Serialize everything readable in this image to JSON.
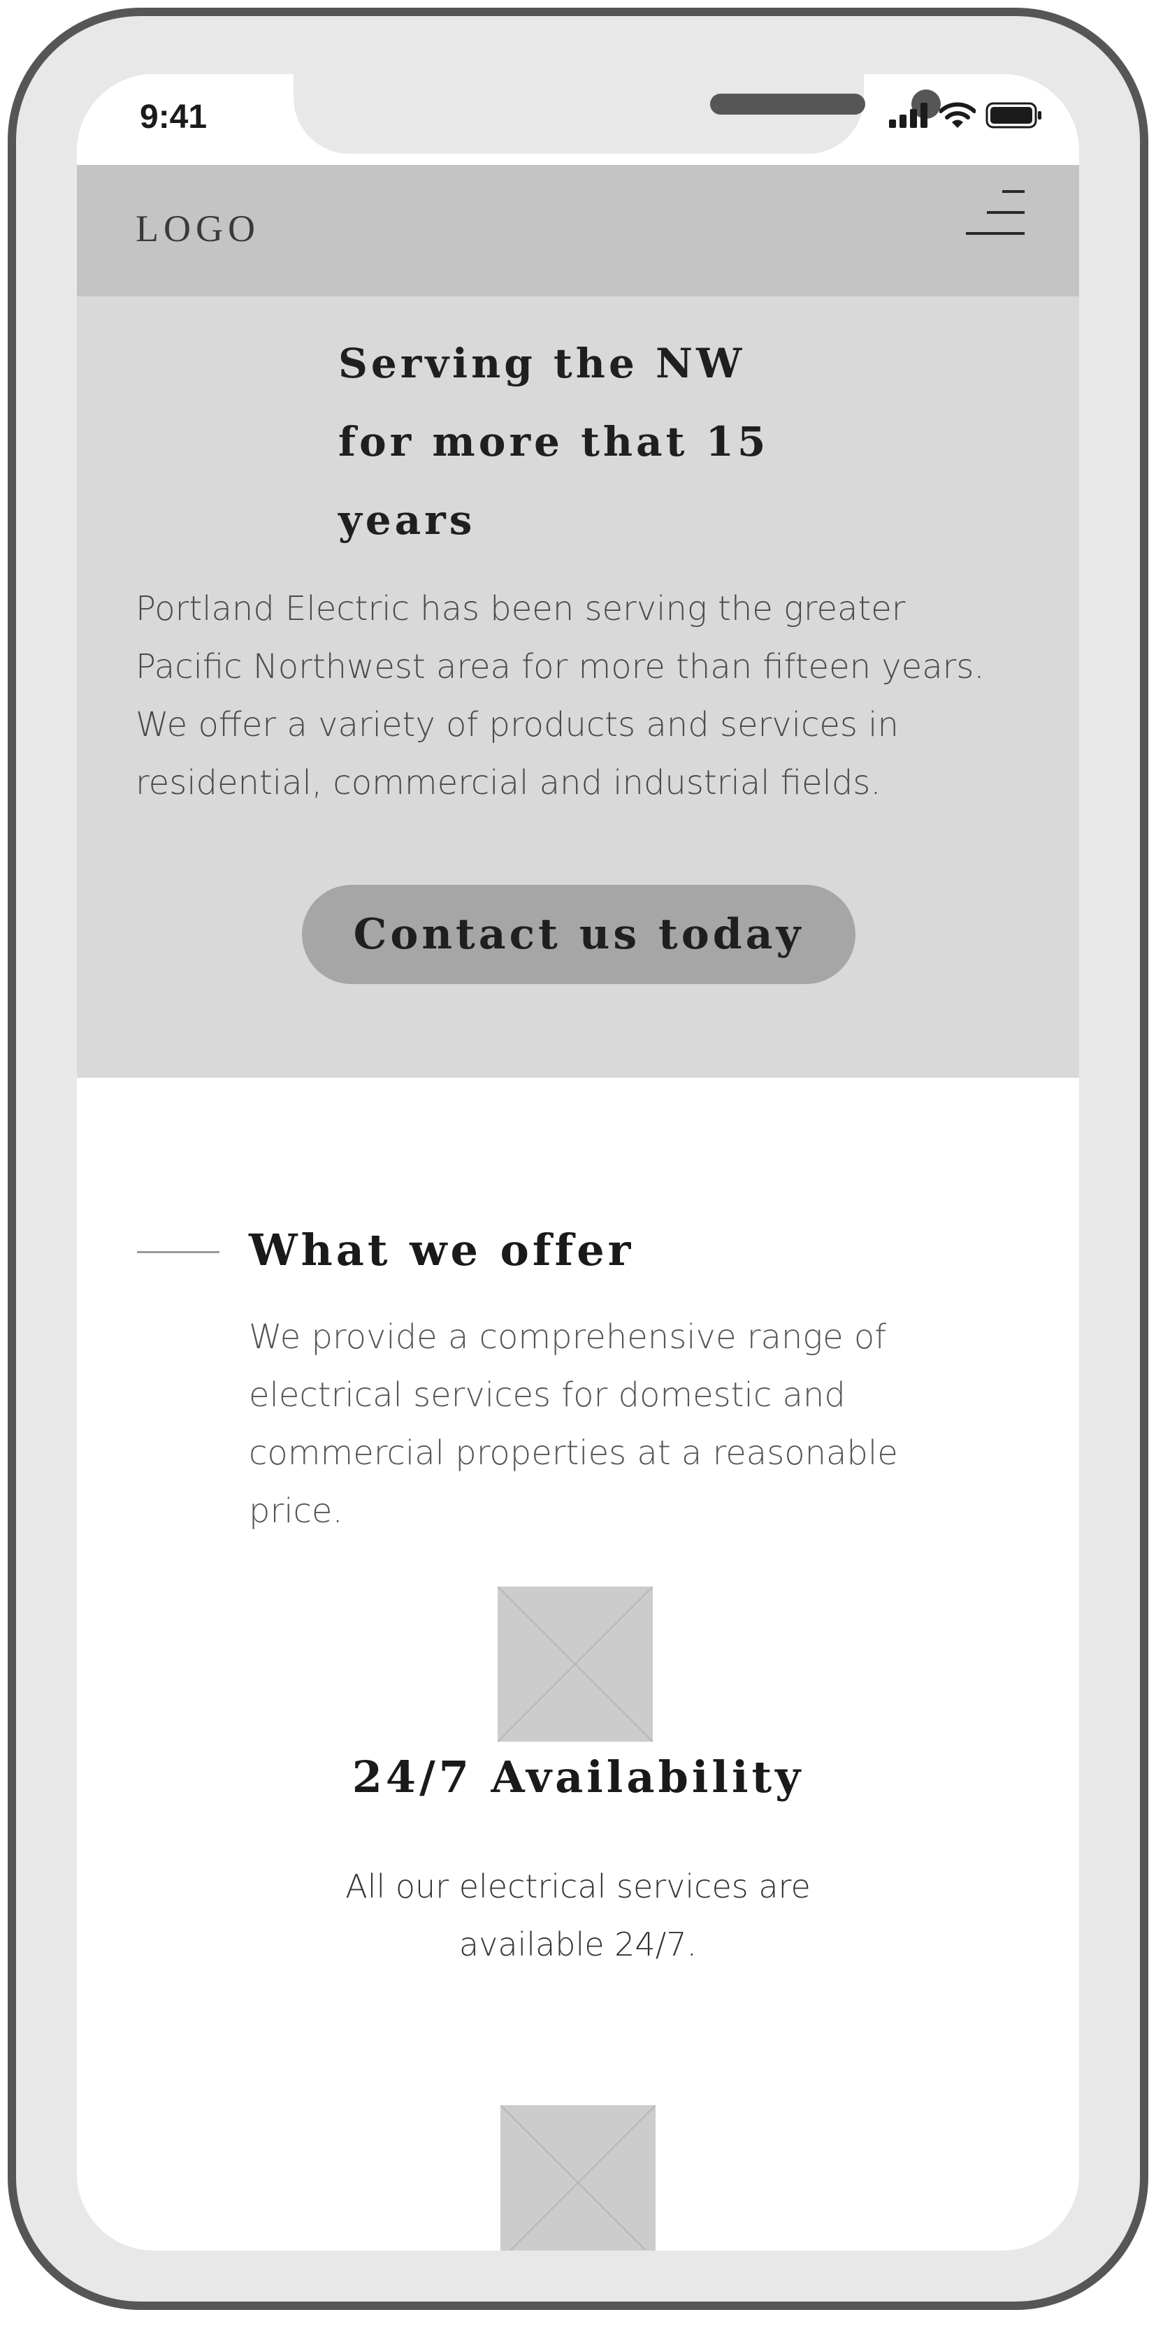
{
  "status_bar": {
    "time": "9:41",
    "icons": [
      "signal-icon",
      "wifi-icon",
      "battery-icon"
    ]
  },
  "nav": {
    "logo": "LOGO",
    "menu_icon": "hamburger-menu-icon"
  },
  "hero": {
    "title_lines": [
      "Serving the NW",
      "for more that 15",
      "years"
    ],
    "text_lines": [
      "Portland Electric has been serving the greater",
      "Pacific Northwest area for more than fifteen years.",
      "We offer a variety of products and services in",
      "residential, commercial and industrial fields."
    ],
    "button_label": "Contact us today"
  },
  "offer": {
    "title": "What we offer",
    "text_lines": [
      "We provide a comprehensive range of",
      "electrical services for domestic and",
      "commercial properties at a reasonable",
      "price."
    ]
  },
  "feature": {
    "image_icon": "image-placeholder-icon",
    "title": "24/7 Availability",
    "text_lines": [
      "All our electrical services are",
      "available 24/7."
    ]
  },
  "colors": {
    "frame": "#565656",
    "bezel": "#e8e8e8",
    "nav_bg": "#c4c4c4",
    "hero_bg": "#dad9d9",
    "button_bg": "#a6a6a6",
    "placeholder": "#cccccc"
  }
}
